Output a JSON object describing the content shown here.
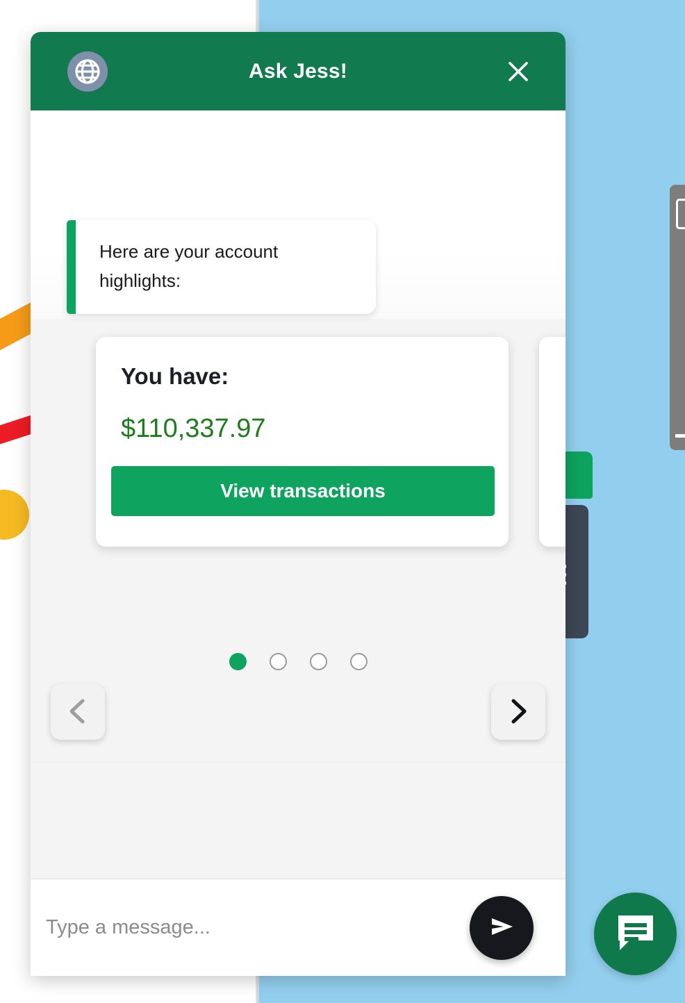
{
  "header": {
    "title": "Ask Jess!",
    "brand_icon": "globe-icon",
    "close_icon": "close-icon",
    "background_color": "#117A4F"
  },
  "conversation": {
    "messages": [
      {
        "sender": "bot",
        "text": "Here are your account highlights:"
      }
    ]
  },
  "carousel": {
    "prev_icon": "chevron-left-icon",
    "next_icon": "chevron-right-icon",
    "prev_enabled": false,
    "next_enabled": true,
    "active_index": 0,
    "total_slides": 4,
    "cards": [
      {
        "title": "You have:",
        "amount": "$110,337.97",
        "amount_color": "#1D7D1D",
        "cta_label": "View transactions",
        "cta_color": "#0EA45F"
      }
    ]
  },
  "composer": {
    "placeholder": "Type a message...",
    "value": "",
    "send_icon": "send-icon",
    "send_button_color": "#16181D"
  },
  "launcher": {
    "icon": "chat-bubble-icon",
    "color": "#10794C"
  },
  "background": {
    "left_color": "#FFFFFF",
    "right_color": "#92CFEE",
    "decorations": [
      "orange-stripe",
      "red-stripe",
      "yellow-circle"
    ],
    "side_tab_icon": "hamburger-icon",
    "side_tab_color": "#3D4654",
    "right_panel_color": "#7D7D7D"
  }
}
